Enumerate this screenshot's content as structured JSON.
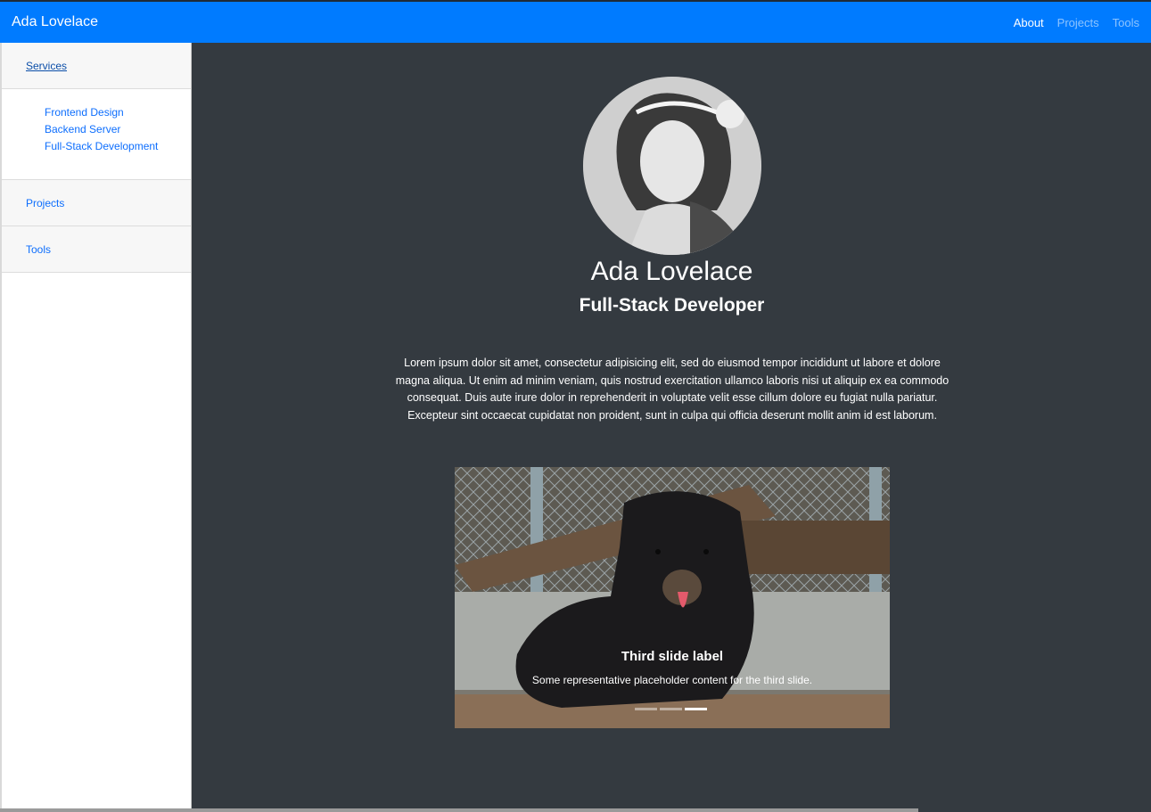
{
  "navbar": {
    "brand": "Ada Lovelace",
    "links": [
      {
        "label": "About",
        "active": true
      },
      {
        "label": "Projects",
        "active": false
      },
      {
        "label": "Tools",
        "active": false
      }
    ],
    "accent": "#007bff"
  },
  "sidebar": {
    "services_label": "Services",
    "service_items": [
      "Frontend Design",
      "Backend Server",
      "Full-Stack Development"
    ],
    "projects_label": "Projects",
    "tools_label": "Tools"
  },
  "profile": {
    "name": "Ada Lovelace",
    "role": "Full-Stack Developer",
    "bio": "Lorem ipsum dolor sit amet, consectetur adipisicing elit, sed do eiusmod tempor incididunt ut labore et dolore magna aliqua. Ut enim ad minim veniam, quis nostrud exercitation ullamco laboris nisi ut aliquip ex ea commodo consequat. Duis aute irure dolor in reprehenderit in voluptate velit esse cillum dolore eu fugiat nulla pariatur. Excepteur sint occaecat cupidatat non proident, sunt in culpa qui officia deserunt mollit anim id est laborum."
  },
  "carousel": {
    "caption_title": "Third slide label",
    "caption_text": "Some representative placeholder content for the third slide.",
    "slide_count": 3,
    "active_slide": 3
  },
  "colors": {
    "background": "#343a40",
    "sidebar_bg": "#ffffff",
    "link": "#0d6efd"
  }
}
